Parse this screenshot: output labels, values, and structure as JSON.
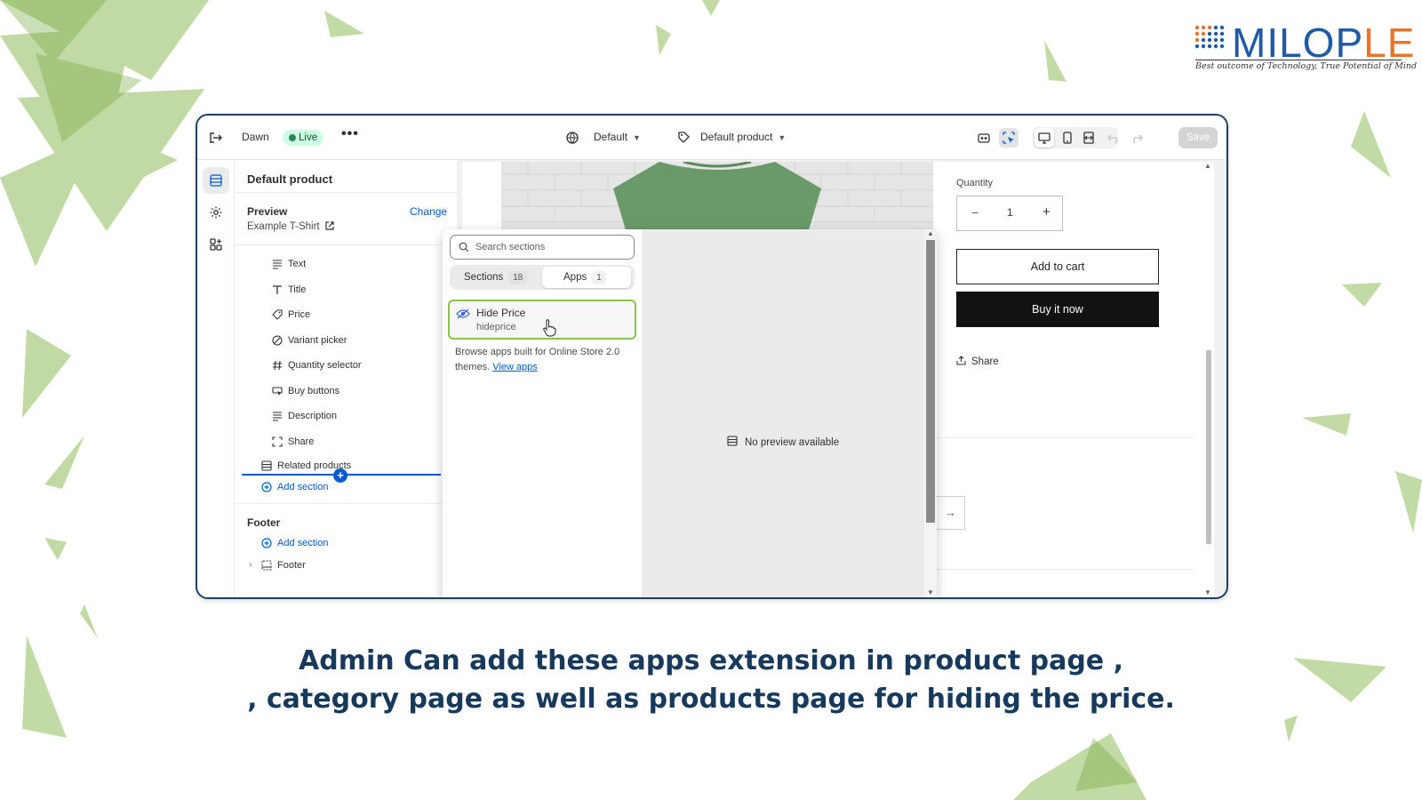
{
  "brand": {
    "logo_main": "MILOP",
    "logo_accent": "LE",
    "tagline": "Best outcome of Technology, True Potential of Mind",
    "primary_color": "#1f5aa6",
    "accent_color": "#e8732a"
  },
  "topbar": {
    "exit_icon": "exit-icon",
    "theme_name": "Dawn",
    "status_badge": "Live",
    "more_icon": "•••",
    "locale_icon": "globe-icon",
    "template_select": "Default",
    "product_icon": "tag-icon",
    "product_select": "Default product",
    "tools": [
      "customer-privacy-icon",
      "inspector-icon",
      "desktop-icon",
      "mobile-icon",
      "fullwidth-icon",
      "undo-icon",
      "redo-icon"
    ],
    "save_label": "Save"
  },
  "rail": {
    "items": [
      "sections-icon",
      "settings-icon",
      "apps-icon"
    ]
  },
  "sidebar": {
    "title": "Default product",
    "preview_label": "Preview",
    "change_link": "Change",
    "preview_value": "Example T-Shirt",
    "blocks": [
      {
        "label": "Text",
        "icon": "text-icon"
      },
      {
        "label": "Title",
        "icon": "title-icon"
      },
      {
        "label": "Price",
        "icon": "price-icon"
      },
      {
        "label": "Variant picker",
        "icon": "variant-icon"
      },
      {
        "label": "Quantity selector",
        "icon": "hash-icon"
      },
      {
        "label": "Buy buttons",
        "icon": "cursor-icon"
      },
      {
        "label": "Description",
        "icon": "text-icon"
      },
      {
        "label": "Share",
        "icon": "share-icon"
      }
    ],
    "related_products": "Related products",
    "add_section": "Add section",
    "footer_group": "Footer",
    "footer_add_section": "Add section",
    "footer_item": "Footer"
  },
  "preview": {
    "quantity_label": "Quantity",
    "quantity_minus": "−",
    "quantity_value": "1",
    "quantity_plus": "+",
    "add_to_cart": "Add to cart",
    "buy_now": "Buy it now",
    "share": "Share",
    "next_arrow": "→"
  },
  "picker": {
    "search_placeholder": "Search sections",
    "tabs": [
      {
        "label": "Sections",
        "count": "18",
        "active": false
      },
      {
        "label": "Apps",
        "count": "1",
        "active": true
      }
    ],
    "app": {
      "name": "Hide Price",
      "handle": "hideprice"
    },
    "browse_text": "Browse apps built for Online Store 2.0 themes.",
    "browse_link": "View apps",
    "no_preview": "No preview available"
  },
  "caption": {
    "line1": "Admin Can add these apps extension in product page ,",
    "line2": ", category page as well as products page for hiding the price."
  }
}
